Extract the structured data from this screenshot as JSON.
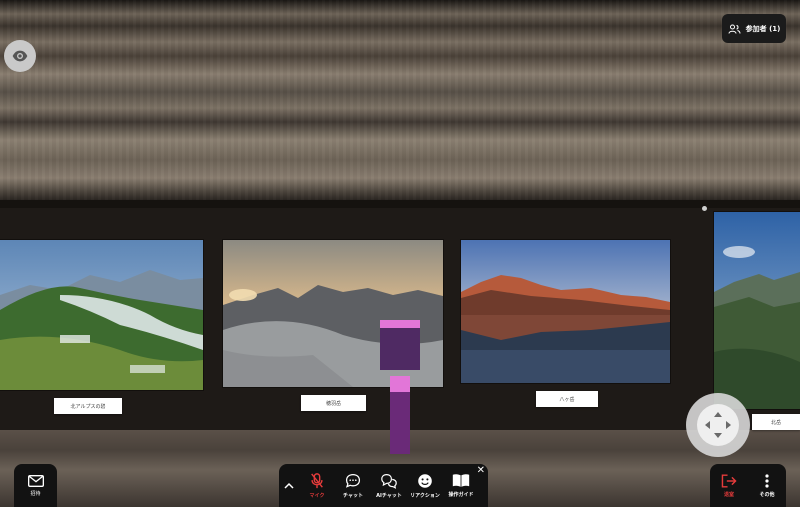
{
  "header": {
    "participants_label": "参加者 (1)"
  },
  "gallery": {
    "artworks": [
      {
        "title": "北アルプスの碧"
      },
      {
        "title": "穂羽岳"
      },
      {
        "title": "八ヶ岳"
      },
      {
        "title": "北岳"
      }
    ]
  },
  "left_controls": {
    "view_icon": "eye-icon",
    "invite_label": "招待"
  },
  "toolbar": {
    "collapse_icon": "chevron-up-icon",
    "items": [
      {
        "label": "マイク",
        "icon": "mic-off-icon",
        "state": "off"
      },
      {
        "label": "チャット",
        "icon": "chat-bubble-icon"
      },
      {
        "label": "AIチャット",
        "icon": "ai-chat-icon"
      },
      {
        "label": "リアクション",
        "icon": "smile-icon"
      },
      {
        "label": "操作ガイド",
        "icon": "book-icon"
      }
    ],
    "close_icon": "close-icon"
  },
  "right_controls": {
    "exit_label": "退室",
    "more_label": "その他"
  },
  "colors": {
    "toolbar_bg": "#121212",
    "mic_off": "#e53b3b",
    "exit": "#e53b3b",
    "avatar_top": "#e276d8",
    "avatar_body": "#4f2a63",
    "avatar_accent": "#e0a24a"
  }
}
